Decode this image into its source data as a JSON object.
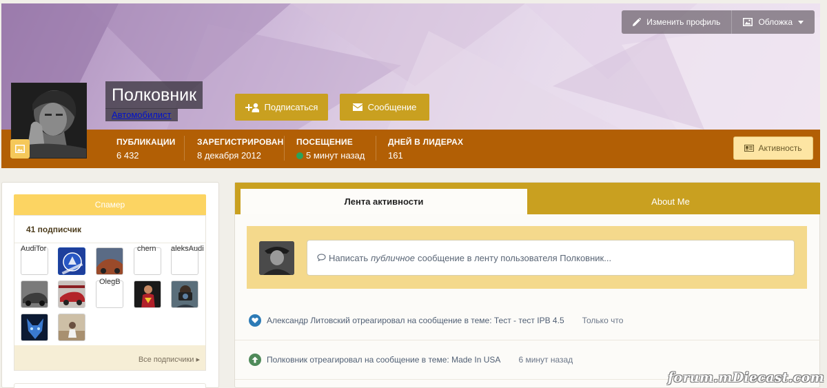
{
  "cover": {
    "edit_profile_label": "Изменить профиль",
    "cover_label": "Обложка",
    "colors": {
      "cover": "#c7b0d4",
      "info_bar": "#b25f05",
      "gold": "#c9a020"
    }
  },
  "profile": {
    "name": "Полковник",
    "rank": "Автомобилист",
    "follow_label": "Подписаться",
    "message_label": "Сообщение",
    "activity_label": "Активность"
  },
  "stats": [
    {
      "label": "ПУБЛИКАЦИИ",
      "value": "6 432"
    },
    {
      "label": "ЗАРЕГИСТРИРОВАН",
      "value": "8 декабря 2012"
    },
    {
      "label": "ПОСЕЩЕНИЕ",
      "value": "5 минут назад"
    },
    {
      "label": "ДНЕЙ В ЛИДЕРАХ",
      "value": "161"
    }
  ],
  "sidebar": {
    "group_badge": "Спамер",
    "followers_title": "41 подписчик",
    "followers": [
      {
        "name": "AudiTor",
        "icon": "avatar-placeholder-icon"
      },
      {
        "name": "",
        "icon": "chelsea-avatar-icon"
      },
      {
        "name": "",
        "icon": "car-avatar-icon"
      },
      {
        "name": "chern",
        "icon": "avatar-placeholder-icon"
      },
      {
        "name": "aleksAudi",
        "icon": "avatar-placeholder-icon"
      },
      {
        "name": "",
        "icon": "car-avatar-icon"
      },
      {
        "name": "",
        "icon": "car-avatar-icon"
      },
      {
        "name": "OlegB",
        "icon": "avatar-placeholder-icon"
      },
      {
        "name": "",
        "icon": "superman-avatar-icon"
      },
      {
        "name": "",
        "icon": "photographer-avatar-icon"
      },
      {
        "name": "",
        "icon": "wolf-avatar-icon"
      },
      {
        "name": "",
        "icon": "person-avatar-icon"
      }
    ],
    "all_followers_label": "Все подписчики"
  },
  "main": {
    "tabs": [
      {
        "label": "Лента активности",
        "active": true
      },
      {
        "label": "About Me",
        "active": false
      }
    ],
    "composer": {
      "prefix": "Написать",
      "emphasis": "публичное",
      "suffix": "сообщение в ленту пользователя Полковник..."
    },
    "feed": [
      {
        "text": "Александр Литовский отреагировал на сообщение в теме: Тест - тест IPB 4.5",
        "time": "Только что",
        "icon": "heart-icon",
        "color": "#2d7bb6"
      },
      {
        "text": "Полковник отреагировал на сообщение в теме: Made In USA",
        "time": "6 минут назад",
        "icon": "arrow-up-icon",
        "color": "#4f8a5a"
      }
    ]
  },
  "watermark": "forum.mDiecast.com"
}
